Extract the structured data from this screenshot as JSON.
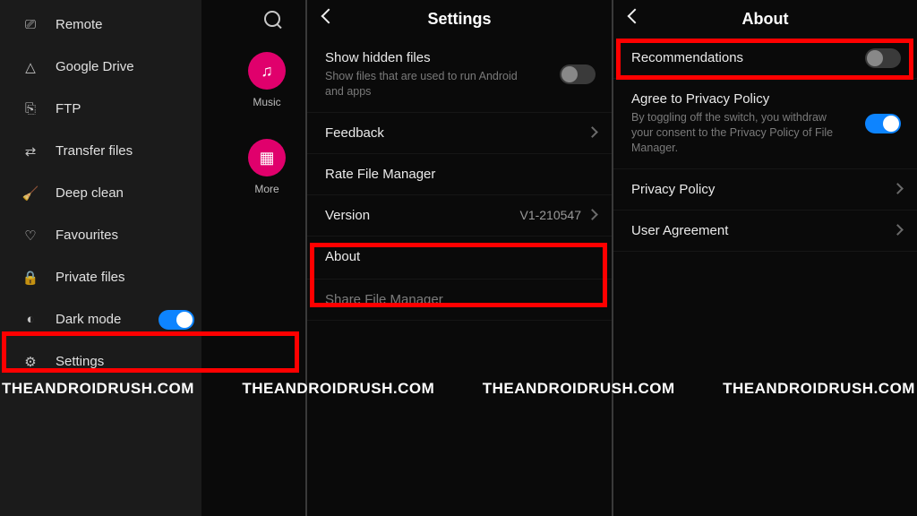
{
  "watermark": "THEANDROIDRUSH.COM",
  "panel1": {
    "drawer_items": [
      {
        "icon": "⎚",
        "label": "Remote"
      },
      {
        "icon": "△",
        "label": "Google Drive"
      },
      {
        "icon": "⎘",
        "label": "FTP"
      },
      {
        "icon": "⇄",
        "label": "Transfer files"
      },
      {
        "icon": "🧹",
        "label": "Deep clean"
      },
      {
        "icon": "♡",
        "label": "Favourites"
      },
      {
        "icon": "🔒",
        "label": "Private files"
      },
      {
        "icon": "◐",
        "label": "Dark mode"
      },
      {
        "icon": "⚙",
        "label": "Settings"
      }
    ],
    "dark_mode_on": true,
    "categories": [
      {
        "glyph": "♫",
        "label": "Music"
      },
      {
        "glyph": "▦",
        "label": "More"
      }
    ]
  },
  "panel2": {
    "title": "Settings",
    "rows": {
      "show_hidden": {
        "title": "Show hidden files",
        "sub": "Show files that are used to run Android and apps",
        "toggle_on": false
      },
      "feedback": {
        "title": "Feedback"
      },
      "rate": {
        "title": "Rate File Manager"
      },
      "version": {
        "title": "Version",
        "value": "V1-210547"
      },
      "about": {
        "title": "About"
      },
      "share": {
        "title": "Share File Manager"
      }
    }
  },
  "panel3": {
    "title": "About",
    "rows": {
      "reco": {
        "title": "Recommendations",
        "toggle_on": false
      },
      "privacy_agree": {
        "title": "Agree to Privacy Policy",
        "sub": "By toggling off the switch, you withdraw your consent to the Privacy Policy of File Manager.",
        "toggle_on": true
      },
      "privacy_policy": {
        "title": "Privacy Policy"
      },
      "user_agreement": {
        "title": "User Agreement"
      }
    }
  }
}
